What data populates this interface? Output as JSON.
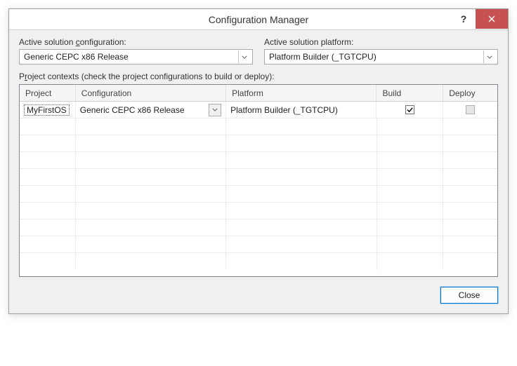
{
  "window": {
    "title": "Configuration Manager"
  },
  "labels": {
    "active_solution_configuration": "Active solution configuration:",
    "active_solution_platform": "Active solution platform:",
    "project_contexts": "Project contexts (check the project configurations to build or deploy):"
  },
  "dropdowns": {
    "active_configuration": "Generic CEPC  x86 Release",
    "active_platform": "Platform Builder (_TGTCPU)"
  },
  "grid": {
    "headers": {
      "project": "Project",
      "configuration": "Configuration",
      "platform": "Platform",
      "build": "Build",
      "deploy": "Deploy"
    },
    "rows": [
      {
        "project": "MyFirstOS",
        "configuration": "Generic CEPC  x86 Release",
        "platform": "Platform Builder (_TGTCPU)",
        "build": true,
        "deploy": false,
        "deploy_disabled": true
      }
    ]
  },
  "buttons": {
    "close": "Close"
  }
}
